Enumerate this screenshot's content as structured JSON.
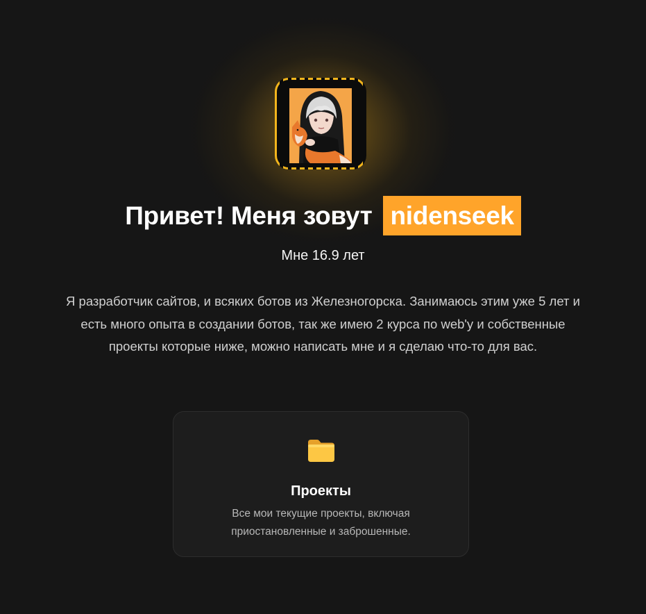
{
  "hero": {
    "greeting": "Привет! Меня зовут",
    "name": "nidenseek",
    "age": "Мне 16.9 лет",
    "bio": "Я разработчик сайтов, и всяких ботов из Железногорска. Занимаюсь этим уже 5 лет и есть много опыта в создании ботов, так же имею 2 курса по web'у и собственные проекты которые ниже, можно написать мне и я сделаю что-то для вас."
  },
  "projects_card": {
    "icon": "folder-icon",
    "title": "Проекты",
    "description": "Все мои текущие проекты, включая приостановленные и заброшенные."
  },
  "colors": {
    "background": "#161616",
    "accent": "#ffa42a",
    "card": "#1d1d1d"
  }
}
